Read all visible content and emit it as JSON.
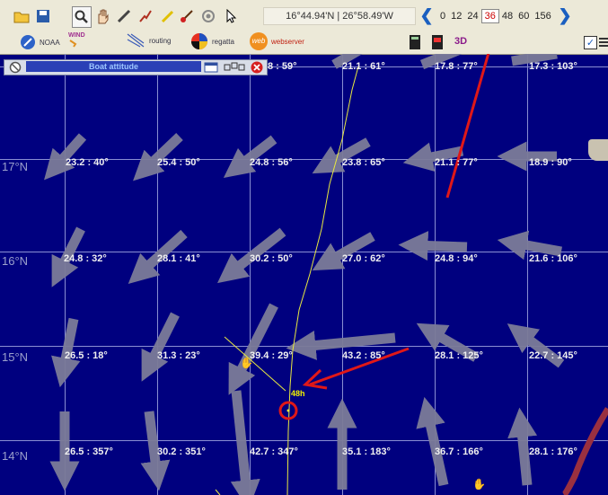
{
  "toolbar": {
    "coords": "16°44.94'N | 26°58.49'W",
    "hours": [
      "0",
      "12",
      "24",
      "36",
      "48",
      "60",
      "156"
    ],
    "selected_hour": "36",
    "noaa": "NOAA",
    "wind": "WIND",
    "routing": "routing",
    "regatta": "regatta",
    "web": "web",
    "webserver": "webserver",
    "threed": "3D"
  },
  "panel": {
    "title": "Boat attitude"
  },
  "latitudes": [
    "17°N",
    "16°N",
    "15°N",
    "14°N"
  ],
  "wind_labels": [
    "8 : 59°",
    "21.1 : 61°",
    "17.8 : 77°",
    "17.3 : 103°",
    "23.2 : 40°",
    "25.4 : 50°",
    "24.8 : 56°",
    "23.8 : 65°",
    "21.1 : 77°",
    "18.9 : 90°",
    "24.8 : 32°",
    "28.1 : 41°",
    "30.2 : 50°",
    "27.0 : 62°",
    "24.8 : 94°",
    "21.6 : 106°",
    "26.5 : 18°",
    "31.3 : 23°",
    "39.4 : 29°",
    "43.2 : 85°",
    "28.1 : 125°",
    "22.7 : 145°",
    "26.5 : 357°",
    "30.2 : 351°",
    "42.7 : 347°",
    "35.1 : 183°",
    "36.7 : 166°",
    "28.1 : 176°"
  ],
  "track_label": "48h",
  "colors": {
    "sea": "#00007f",
    "arrow": "#7c7c99",
    "annotation": "#e01818",
    "track": "#e8e840"
  }
}
